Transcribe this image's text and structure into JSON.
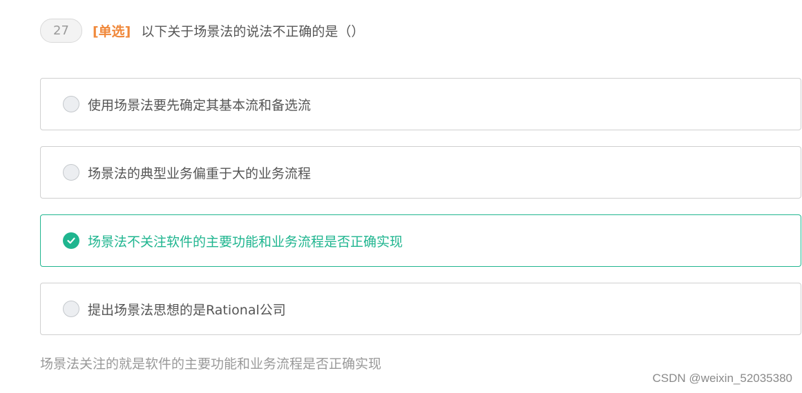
{
  "question": {
    "number": "27",
    "type_label": "[单选]",
    "text": "以下关于场景法的说法不正确的是（）"
  },
  "options": [
    {
      "label": "使用场景法要先确定其基本流和备选流",
      "selected": false
    },
    {
      "label": "场景法的典型业务偏重于大的业务流程",
      "selected": false
    },
    {
      "label": "场景法不关注软件的主要功能和业务流程是否正确实现",
      "selected": true
    },
    {
      "label": "提出场景法思想的是Rational公司",
      "selected": false
    }
  ],
  "explanation": "场景法关注的就是软件的主要功能和业务流程是否正确实现",
  "watermark": "CSDN @weixin_52035380",
  "icons": {
    "radio_unchecked": "radio-empty-icon",
    "radio_checked": "checkmark-circle-icon"
  },
  "colors": {
    "accent": "#1fb58f",
    "type_label": "#f0883a",
    "text": "#555555",
    "muted": "#999999"
  }
}
